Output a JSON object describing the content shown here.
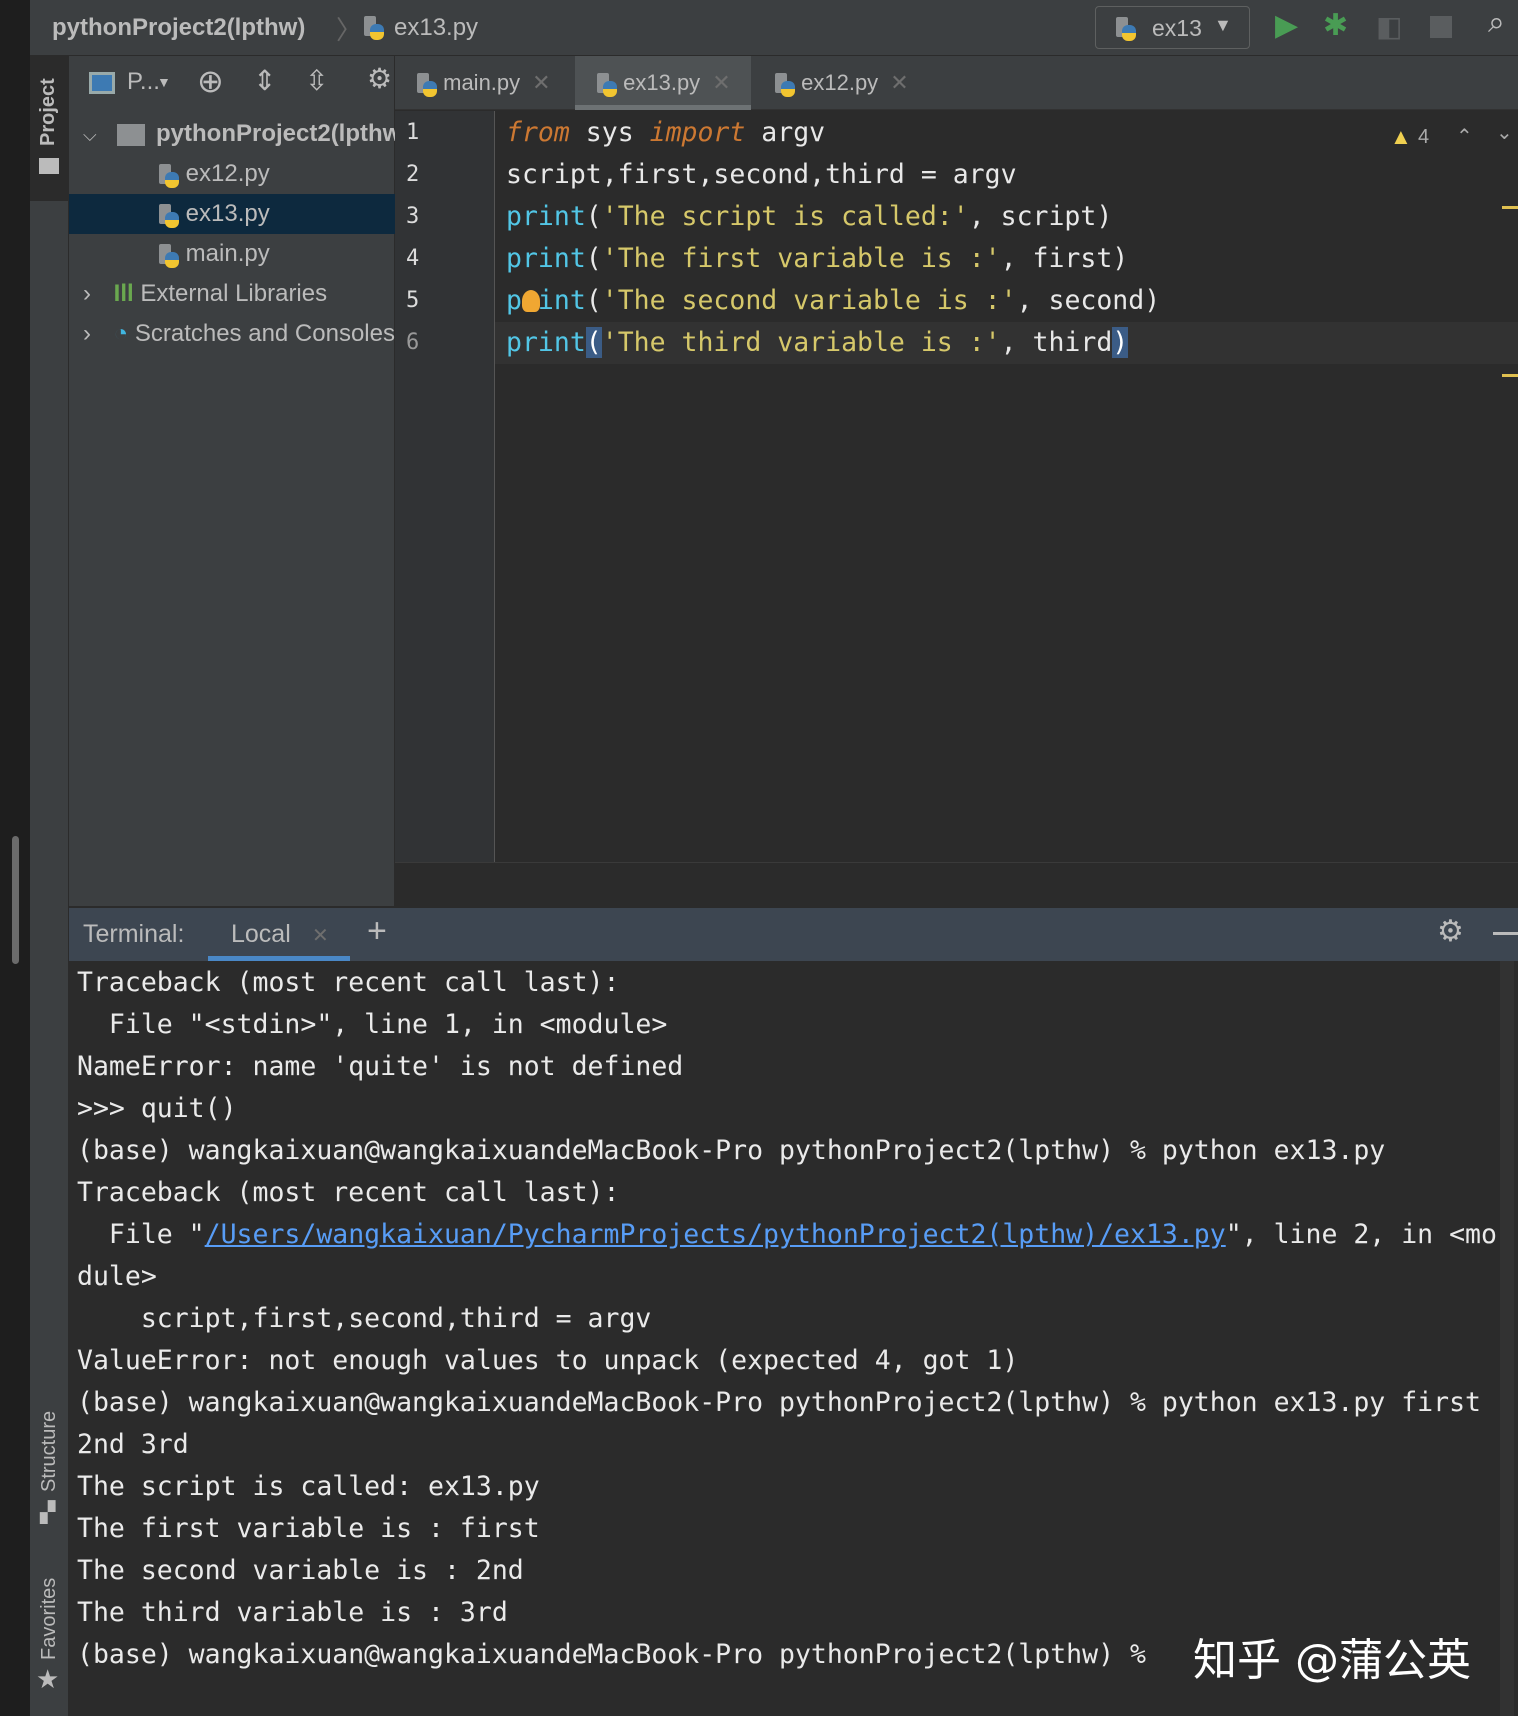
{
  "breadcrumb": {
    "project": "pythonProject2(lpthw)",
    "file": "ex13.py"
  },
  "run_config": {
    "label": "ex13"
  },
  "side_stripe": {
    "project": "Project",
    "structure": "Structure",
    "favorites": "Favorites"
  },
  "project_panel": {
    "view_label": "P...",
    "tree": [
      {
        "label": "pythonProject2(lpthw)",
        "type": "folder",
        "expanded": true
      },
      {
        "label": "ex12.py",
        "type": "py"
      },
      {
        "label": "ex13.py",
        "type": "py",
        "selected": true
      },
      {
        "label": "main.py",
        "type": "py"
      },
      {
        "label": "External Libraries",
        "type": "lib"
      },
      {
        "label": "Scratches and Consoles",
        "type": "scratch"
      }
    ]
  },
  "tabs": [
    {
      "label": "main.py"
    },
    {
      "label": "ex13.py",
      "active": true
    },
    {
      "label": "ex12.py"
    }
  ],
  "editor": {
    "warnings": "4",
    "line_numbers": [
      "1",
      "2",
      "3",
      "4",
      "5",
      "6"
    ],
    "lines": [
      {
        "a": "from",
        "b": " sys ",
        "c": "import",
        "d": " argv"
      },
      {
        "a": "script,first,second,third = argv"
      },
      {
        "a": "print",
        "b": "(",
        "c": "'The script is called:'",
        "d": ", script)"
      },
      {
        "a": "print",
        "b": "(",
        "c": "'The first variable is :'",
        "d": ", first)"
      },
      {
        "a": "print",
        "b": "(",
        "c": "'The second variable is :'",
        "d": ", second)"
      },
      {
        "a": "print",
        "b": "(",
        "c": "'The third variable is :'",
        "d": ", third",
        "e": ")"
      }
    ]
  },
  "terminal": {
    "title": "Terminal:",
    "tab": "Local",
    "lines": [
      "Traceback (most recent call last):",
      "  File \"<stdin>\", line 1, in <module>",
      "NameError: name 'quite' is not defined",
      ">>> quit()",
      "(base) wangkaixuan@wangkaixuandeMacBook-Pro pythonProject2(lpthw) % python ex13.py",
      "Traceback (most recent call last):",
      "dule>",
      "    script,first,second,third = argv",
      "ValueError: not enough values to unpack (expected 4, got 1)",
      "(base) wangkaixuan@wangkaixuandeMacBook-Pro pythonProject2(lpthw) % python ex13.py first",
      "2nd 3rd",
      "The script is called: ex13.py",
      "The first variable is : first",
      "The second variable is : 2nd",
      "The third variable is : 3rd",
      "(base) wangkaixuan@wangkaixuandeMacBook-Pro pythonProject2(lpthw) %"
    ],
    "file_line": {
      "pre": "  File \"",
      "link": "/Users/wangkaixuan/PycharmProjects/pythonProject2(lpthw)/ex13.py",
      "post": "\", line 2, in <mo"
    }
  },
  "watermark": "知乎 @蒲公英"
}
